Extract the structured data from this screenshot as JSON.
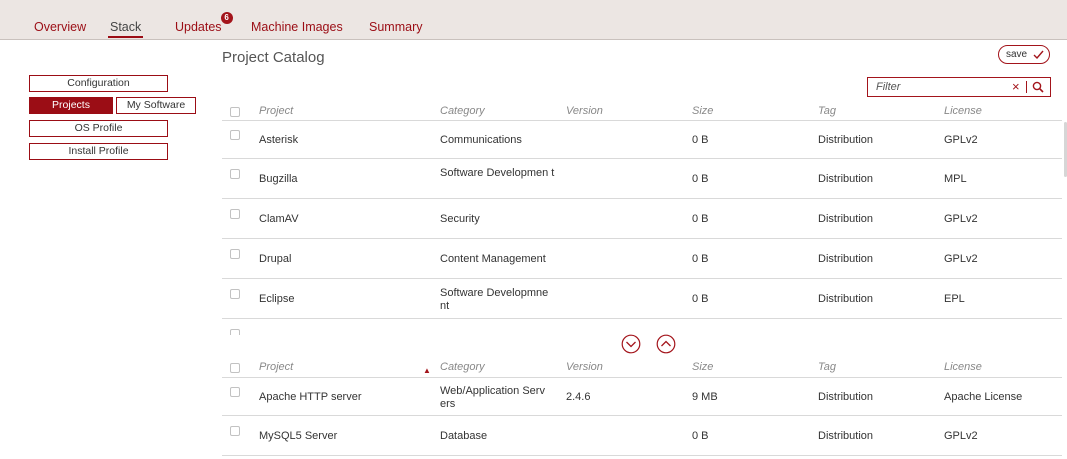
{
  "nav": {
    "tabs": [
      {
        "label": "Overview"
      },
      {
        "label": "Stack"
      },
      {
        "label": "Updates",
        "badge": "6"
      },
      {
        "label": "Machine Images"
      },
      {
        "label": "Summary"
      }
    ],
    "active": "Stack"
  },
  "sidebar": {
    "configuration": "Configuration",
    "projects": "Projects",
    "my_software": "My Software",
    "os_profile": "OS Profile",
    "install_profile": "Install Profile"
  },
  "catalog": {
    "title": "Project Catalog",
    "save_label": "save",
    "filter_placeholder": "Filter",
    "columns": [
      "Project",
      "Category",
      "Version",
      "Size",
      "Tag",
      "License"
    ],
    "rows": [
      {
        "project": "Asterisk",
        "category": "Communications",
        "version": "",
        "size": "0 B",
        "tag": "Distribution",
        "license": "GPLv2"
      },
      {
        "project": "Bugzilla",
        "category": "Software Developmen t",
        "version": "",
        "size": "0 B",
        "tag": "Distribution",
        "license": "MPL"
      },
      {
        "project": "ClamAV",
        "category": "Security",
        "version": "",
        "size": "0 B",
        "tag": "Distribution",
        "license": "GPLv2"
      },
      {
        "project": "Drupal",
        "category": "Content Management",
        "version": "",
        "size": "0 B",
        "tag": "Distribution",
        "license": "GPLv2"
      },
      {
        "project": "Eclipse",
        "category": "Software Developmne nt",
        "version": "",
        "size": "0 B",
        "tag": "Distribution",
        "license": "EPL"
      },
      {
        "project": "",
        "category": "",
        "version": "",
        "size": "",
        "tag": "",
        "license": ""
      }
    ]
  },
  "selected": {
    "columns": [
      "Project",
      "Category",
      "Version",
      "Size",
      "Tag",
      "License"
    ],
    "sort_column": "Project",
    "rows": [
      {
        "project": "Apache HTTP server",
        "category": "Web/Application Serv ers",
        "version": "2.4.6",
        "size": "9 MB",
        "tag": "Distribution",
        "license": "Apache License"
      },
      {
        "project": "MySQL5 Server",
        "category": "Database",
        "version": "",
        "size": "0 B",
        "tag": "Distribution",
        "license": "GPLv2"
      }
    ]
  },
  "icons": {
    "save": "checkmark-icon",
    "filter_clear": "close-icon",
    "filter_search": "search-icon",
    "move_down": "chevron-down-circle-icon",
    "move_up": "chevron-up-circle-icon",
    "sort": "sort-ascending-icon"
  },
  "colors": {
    "accent": "#9b0d15",
    "nav_bg": "#ece6e3",
    "row_divider": "#d9d9d9"
  }
}
